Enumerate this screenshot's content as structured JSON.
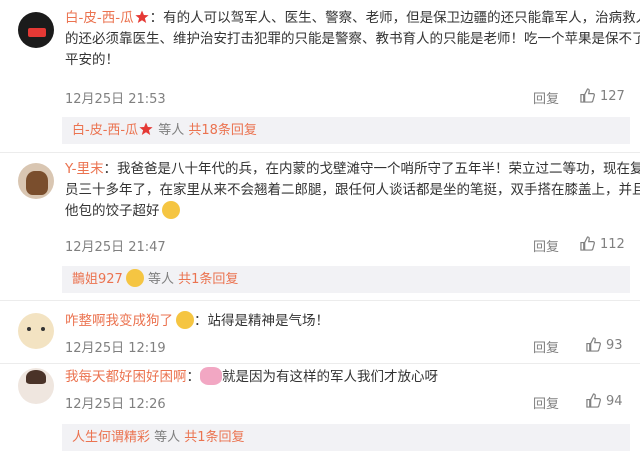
{
  "comments": [
    {
      "username": "白-皮-西-瓜",
      "colon": "：",
      "lines": [
        "有的人可以驾军人、医生、警察、老师，但是保卫边疆的还只能靠军人，治病救人",
        "的还必须靠医生、维护治安打击犯罪的只能是警察、教书育人的只能是老师！吃一个苹果是保不了",
        "平安的！"
      ],
      "time": "12月25日 21:53",
      "reply": "回复",
      "likes": "127",
      "sub": {
        "user": "白-皮-西-瓜",
        "text": " 等人 ",
        "link": "共18条回复"
      }
    },
    {
      "username": "Y-里末",
      "colon": "：",
      "lines": [
        "我爸爸是八十年代的兵，在内蒙的戈壁滩守一个哨所守了五年半！荣立过二等功，现在复",
        "员三十多年了，在家里从来不会翘着二郎腿，跟任何人谈话都是坐的笔挺，双手搭在膝盖上，并且",
        "他包的饺子超好"
      ],
      "time": "12月25日 21:47",
      "reply": "回复",
      "likes": "112",
      "sub": {
        "user": "鵲姐927",
        "text": " 等人 ",
        "link": "共1条回复"
      }
    },
    {
      "username": "咋整啊我变成狗了",
      "colon": "：",
      "lines": [
        "站得是精神是气场！"
      ],
      "time": "12月25日 12:19",
      "reply": "回复",
      "likes": "93"
    },
    {
      "username": "我每天都好困好困啊",
      "colon": "：",
      "lines": [
        "就是因为有这样的军人我们才放心呀"
      ],
      "time": "12月25日 12:26",
      "reply": "回复",
      "likes": "94",
      "sub": {
        "user": "人生何谓精彩",
        "text": " 等人 ",
        "link": "共1条回复"
      }
    }
  ],
  "icons": {
    "like": "thumbs-up-icon",
    "badge": "star-badge-icon",
    "emoji": "smile-emoji-icon"
  },
  "colors": {
    "username": "#eb7350",
    "meta": "#808080",
    "subbox_bg": "#f2f2f5"
  }
}
